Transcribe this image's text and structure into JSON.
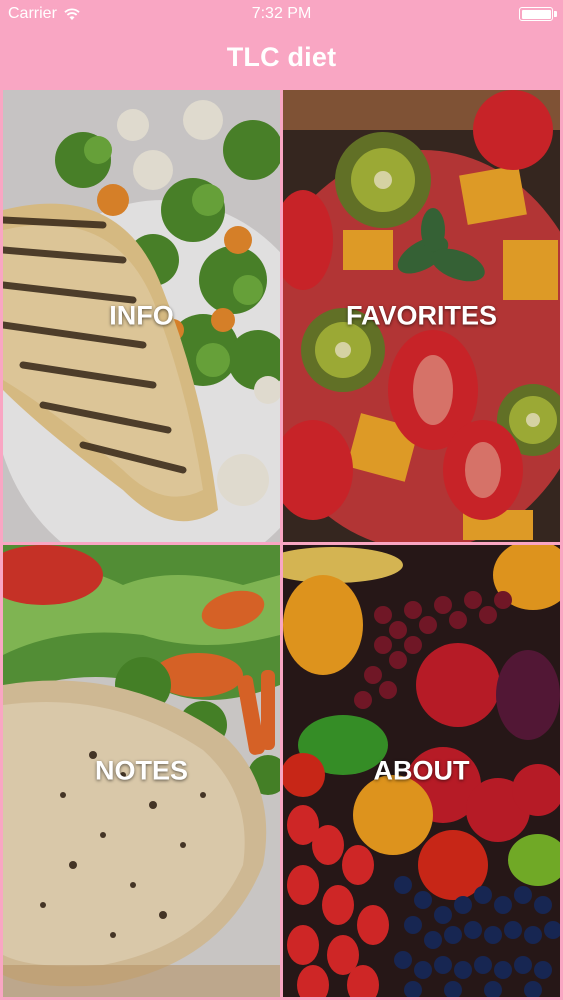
{
  "status_bar": {
    "carrier": "Carrier",
    "time": "7:32 PM",
    "wifi_icon": "wifi-icon",
    "battery_icon": "battery-icon"
  },
  "nav": {
    "title": "TLC diet"
  },
  "tiles": [
    {
      "label": "INFO",
      "image": "grilled-chicken-broccoli-photo"
    },
    {
      "label": "FAVORITES",
      "image": "fruit-salad-photo"
    },
    {
      "label": "NOTES",
      "image": "chicken-vegetables-photo"
    },
    {
      "label": "ABOUT",
      "image": "fruits-vegetables-market-photo"
    }
  ],
  "colors": {
    "accent": "#f9a6c3"
  }
}
